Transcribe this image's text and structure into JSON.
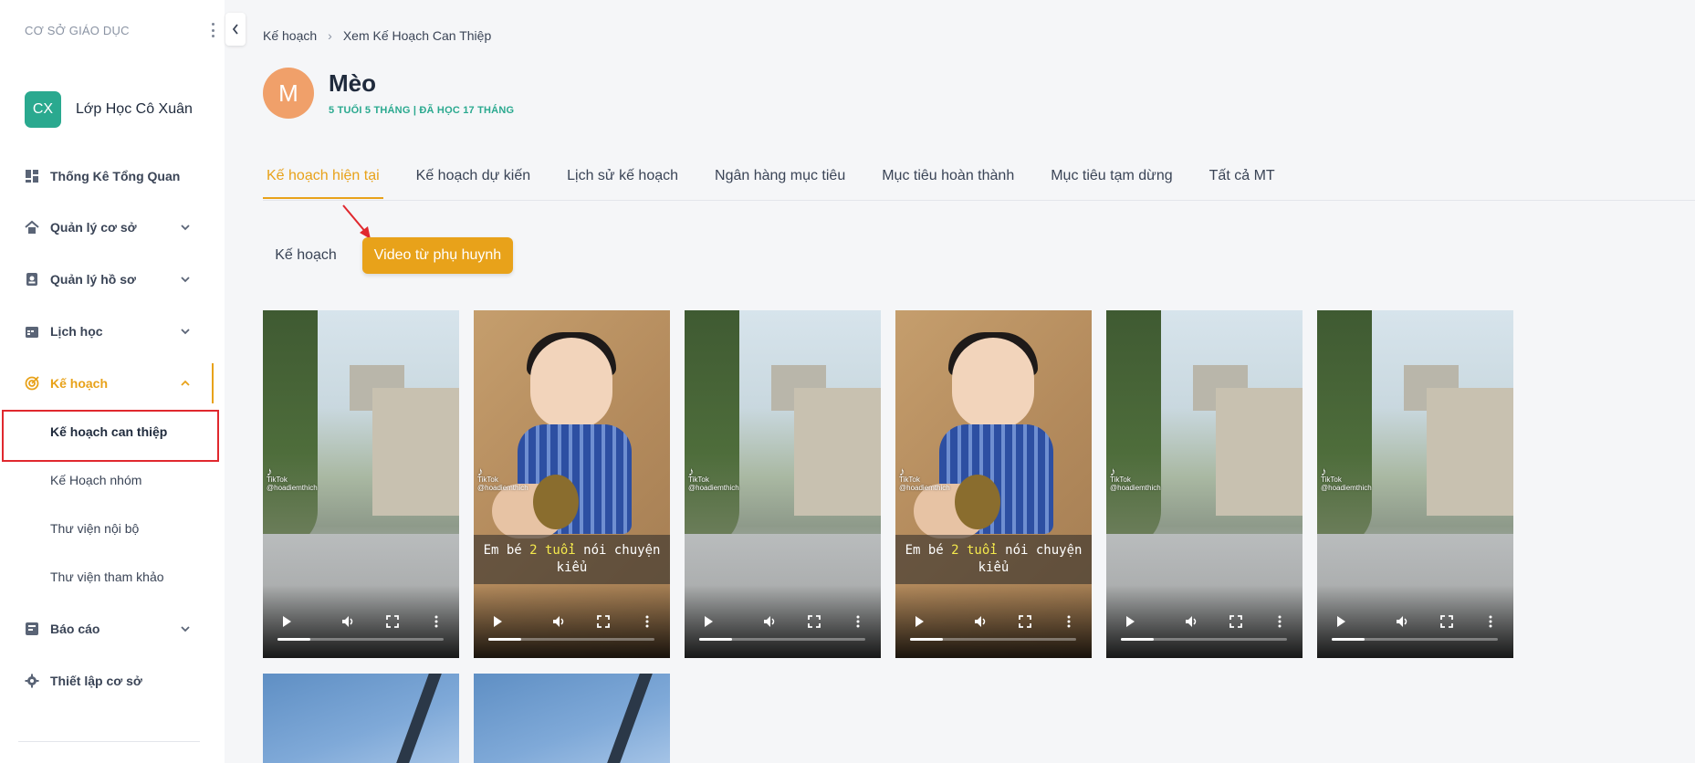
{
  "sidebar": {
    "org_title": "CƠ SỞ GIÁO DỤC",
    "class_avatar": "CX",
    "class_name": "Lớp Học Cô Xuân",
    "items": [
      {
        "label": "Thống Kê Tổng Quan",
        "icon": "dashboard-icon"
      },
      {
        "label": "Quản lý cơ sở",
        "icon": "home-icon"
      },
      {
        "label": "Quản lý hồ sơ",
        "icon": "profile-icon"
      },
      {
        "label": "Lịch học",
        "icon": "calendar-icon"
      },
      {
        "label": "Kế hoạch",
        "icon": "target-icon"
      },
      {
        "label": "Báo cáo",
        "icon": "report-icon"
      },
      {
        "label": "Thiết lập cơ sở",
        "icon": "gear-icon"
      }
    ],
    "subitems": [
      {
        "label": "Kế hoạch can thiệp"
      },
      {
        "label": "Kế Hoạch nhóm"
      },
      {
        "label": "Thư viện nội bộ"
      },
      {
        "label": "Thư viện tham khảo"
      }
    ]
  },
  "breadcrumb": {
    "root": "Kế hoạch",
    "current": "Xem Kế Hoạch Can Thiệp"
  },
  "student": {
    "initial": "M",
    "name": "Mèo",
    "meta": "5 TUỔI 5 THÁNG | ĐÃ HỌC 17 THÁNG"
  },
  "tabs": [
    {
      "label": "Kế hoạch hiện tại"
    },
    {
      "label": "Kế hoạch dự kiến"
    },
    {
      "label": "Lịch sử kế hoạch"
    },
    {
      "label": "Ngân hàng mục tiêu"
    },
    {
      "label": "Mục tiêu hoàn thành"
    },
    {
      "label": "Mục tiêu tạm dừng"
    },
    {
      "label": "Tất cả MT"
    }
  ],
  "segments": {
    "plan": "Kế hoạch",
    "videos": "Video từ phụ huynh"
  },
  "videos": {
    "caption_a": "Em bé ",
    "caption_b": "2 tuổi",
    "caption_c": " nói chuyện",
    "caption_d": "kiểu",
    "tiktok_label": "TikTok",
    "tiktok_user": "@hoadiemthich",
    "progress_fraction": 0.2
  },
  "colors": {
    "accent": "#e8a21a",
    "teal": "#2aa98f",
    "highlight_box": "#e0282e"
  }
}
